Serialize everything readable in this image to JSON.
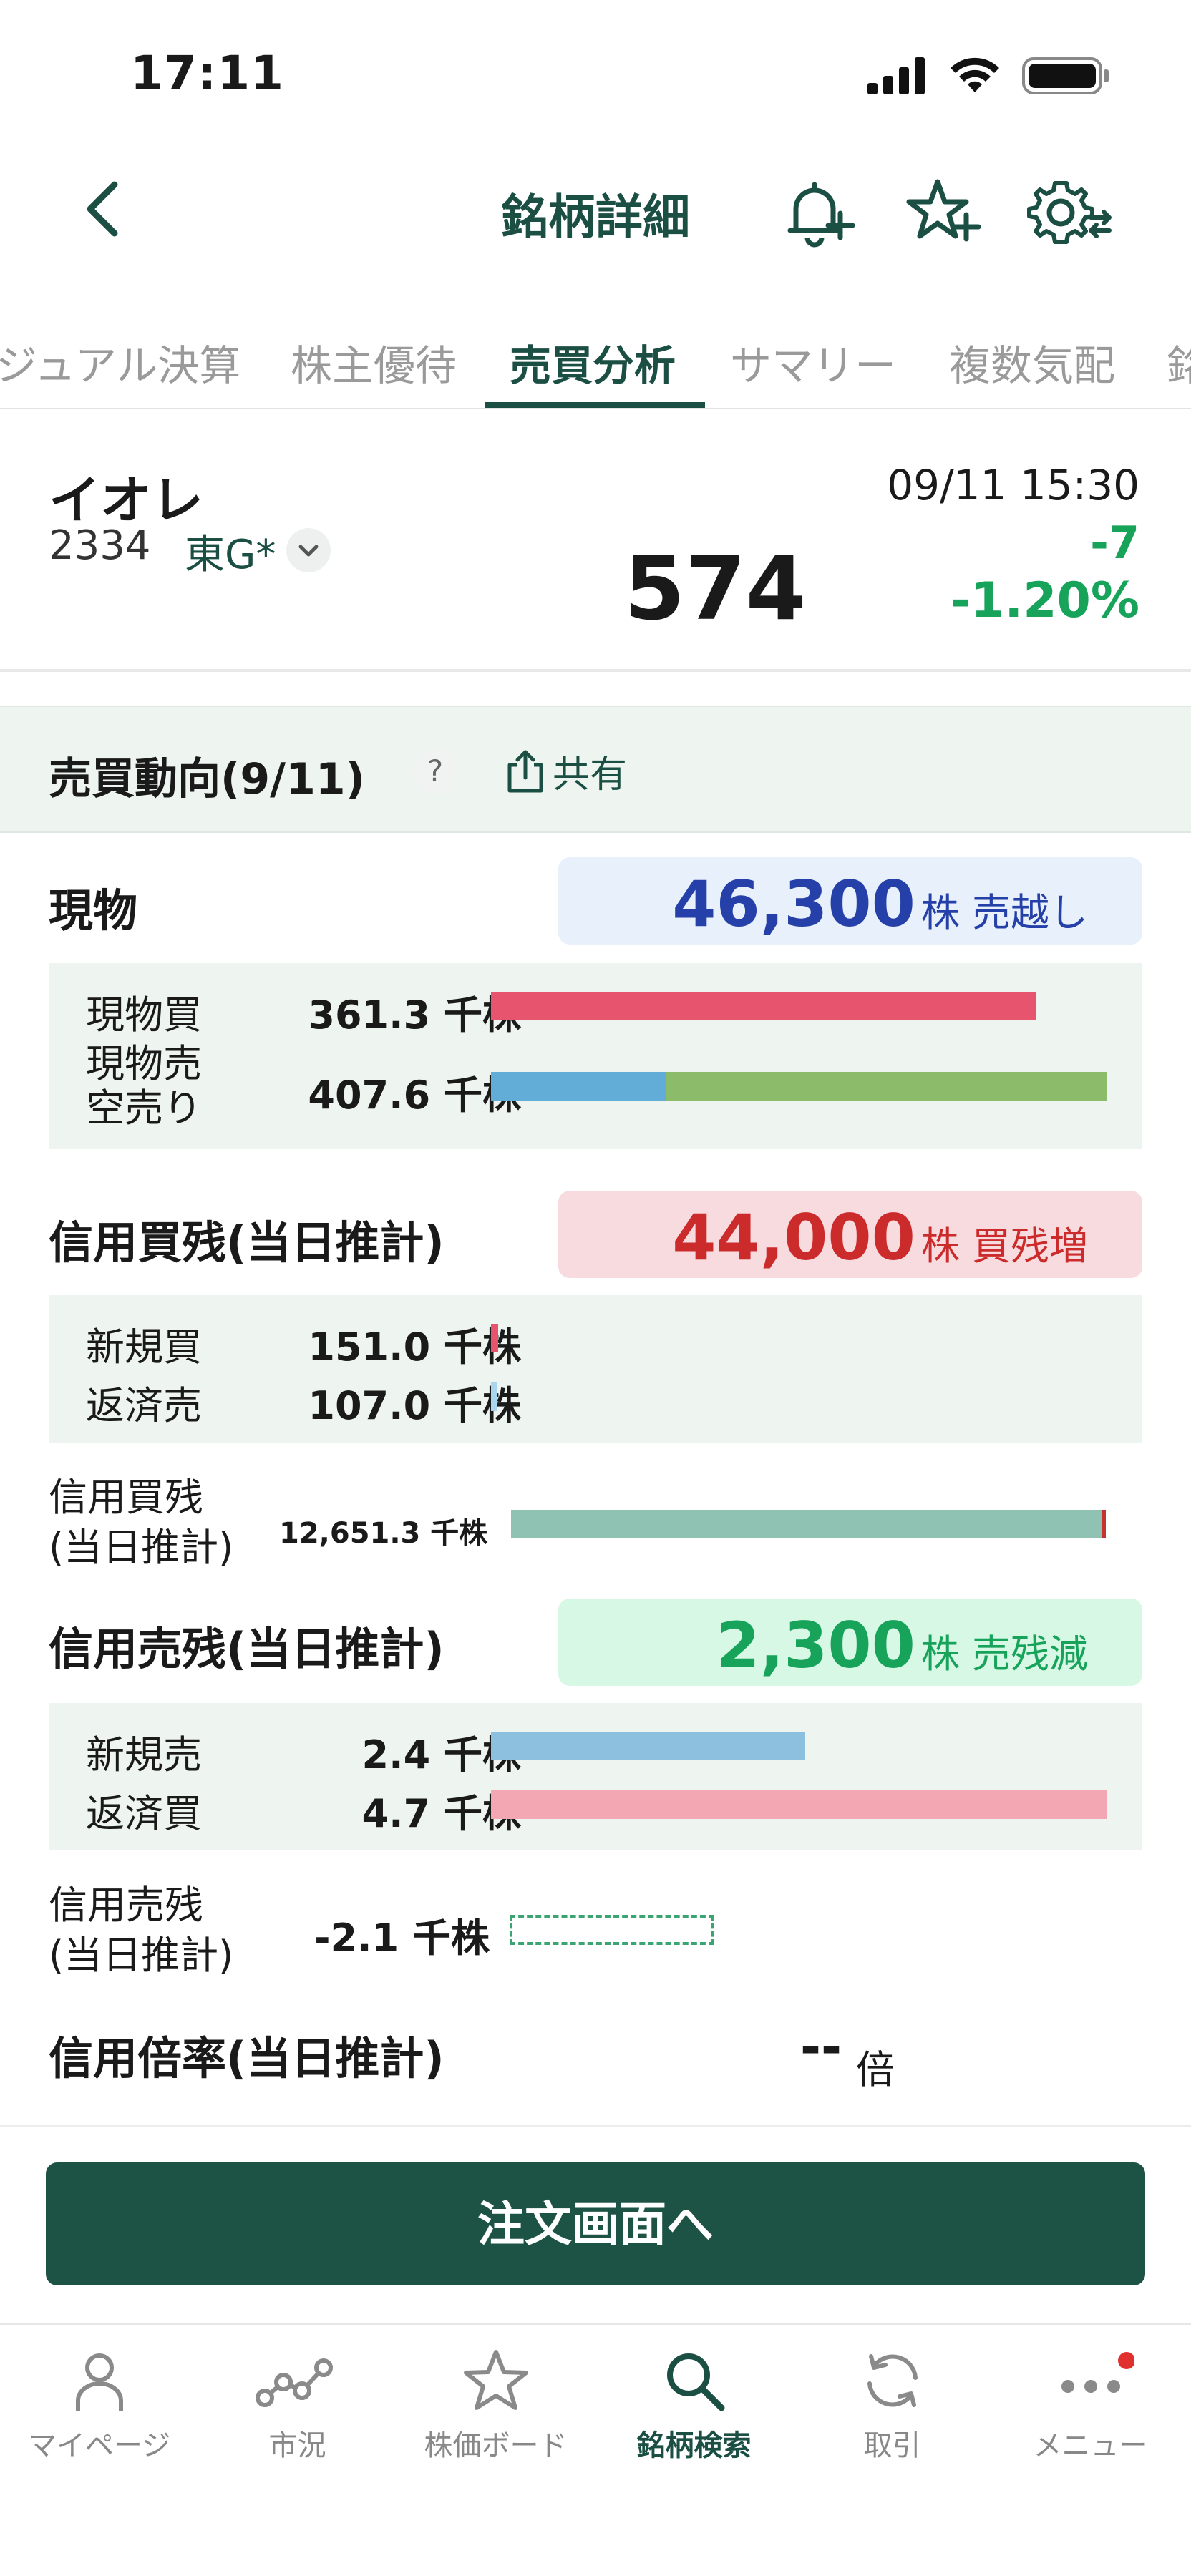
{
  "status": {
    "time": "17:11"
  },
  "header": {
    "title": "銘柄詳細"
  },
  "tabs": [
    {
      "label": "ジュアル決算"
    },
    {
      "label": "株主優待"
    },
    {
      "label": "売買分析"
    },
    {
      "label": "サマリー"
    },
    {
      "label": "複数気配"
    },
    {
      "label": "銘"
    }
  ],
  "stock": {
    "name": "イオレ",
    "code": "2334",
    "market": "東G*",
    "datetime": "09/11 15:30",
    "price": "574",
    "change": "-7",
    "change_pct": "-1.20%"
  },
  "section": {
    "title": "売買動向(9/11)",
    "help": "?",
    "share": "共有"
  },
  "genbutsu": {
    "title": "現物",
    "pill_value": "46,300",
    "pill_unit": "株 売越し",
    "buy_label": "現物買",
    "buy_value": "361.3 千株",
    "buy_ratio": 0.886,
    "sell_label_1": "現物売",
    "sell_label_2": "空売り",
    "sell_value": "407.6 千株",
    "sell_split_ratio": 0.284
  },
  "shinyo_kai": {
    "title": "信用買残(当日推計)",
    "pill_value": "44,000",
    "pill_unit": "株 買残増",
    "new_label": "新規買",
    "new_value": "151.0 千株",
    "repay_label": "返済売",
    "repay_value": "107.0 千株",
    "balance_label_1": "信用買残",
    "balance_label_2": "(当日推計)",
    "balance_value": "12,651.3 千株"
  },
  "shinyo_uri": {
    "title": "信用売残(当日推計)",
    "pill_value": "2,300",
    "pill_unit": "株 売残減",
    "new_label": "新規売",
    "new_value": "2.4 千株",
    "new_ratio": 0.51,
    "repay_label": "返済買",
    "repay_value": "4.7 千株",
    "balance_label_1": "信用売残",
    "balance_label_2": "(当日推計)",
    "balance_value": "-2.1 千株"
  },
  "ratio": {
    "title": "信用倍率(当日推計)",
    "value": "--",
    "unit": "倍"
  },
  "order_button": "注文画面へ",
  "nav": [
    {
      "label": "マイページ",
      "icon": "person-icon"
    },
    {
      "label": "市況",
      "icon": "market-icon"
    },
    {
      "label": "株価ボード",
      "icon": "star-icon"
    },
    {
      "label": "銘柄検索",
      "icon": "search-icon"
    },
    {
      "label": "取引",
      "icon": "refresh-icon"
    },
    {
      "label": "メニュー",
      "icon": "more-icon"
    }
  ],
  "colors": {
    "brand": "#1c4f44",
    "up": "#d23a3a",
    "down": "#17a35a",
    "buy_bar": "#e6546d",
    "sell_bar": "#62acd8",
    "short_bar": "#8cbb6a",
    "margin_bar": "#8fc2b2"
  }
}
